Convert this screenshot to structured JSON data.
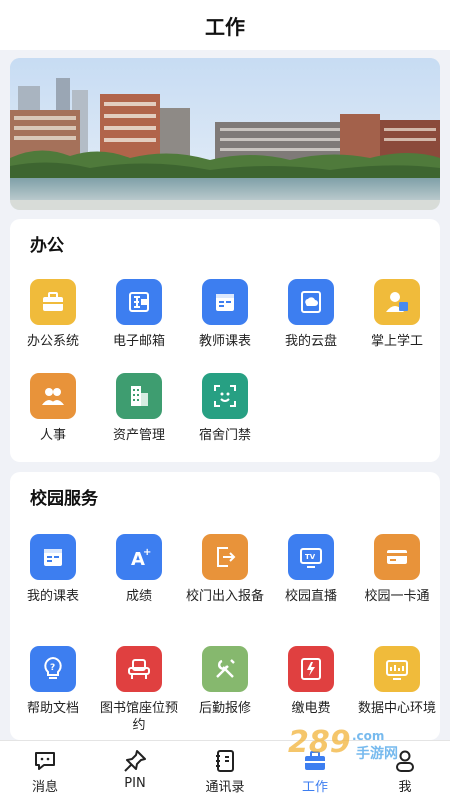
{
  "header": {
    "title": "工作"
  },
  "colors": {
    "accent": "#3d7ef0",
    "yellow": "#f0bb3b",
    "orange": "#e8933a",
    "green": "#3e9d70",
    "red": "#e04040",
    "page_bg": "#f0f2f7"
  },
  "office": {
    "title": "办公",
    "items": [
      {
        "label": "办公系统",
        "icon": "briefcase-icon"
      },
      {
        "label": "电子邮箱",
        "icon": "email-icon"
      },
      {
        "label": "教师课表",
        "icon": "calendar-icon"
      },
      {
        "label": "我的云盘",
        "icon": "cloud-icon"
      },
      {
        "label": "掌上学工",
        "icon": "student-icon"
      },
      {
        "label": "人事",
        "icon": "people-icon"
      },
      {
        "label": "资产管理",
        "icon": "building-icon"
      },
      {
        "label": "宿舍门禁",
        "icon": "face-scan-icon"
      }
    ]
  },
  "campus": {
    "title": "校园服务",
    "items": [
      {
        "label": "我的课表",
        "icon": "calendar-icon"
      },
      {
        "label": "成绩",
        "icon": "grade-icon"
      },
      {
        "label": "校门出入报备",
        "icon": "door-exit-icon"
      },
      {
        "label": "校园直播",
        "icon": "tv-icon"
      },
      {
        "label": "校园一卡通",
        "icon": "card-icon"
      },
      {
        "label": "帮助文档",
        "icon": "help-bulb-icon"
      },
      {
        "label": "图书馆座位预约",
        "icon": "seat-icon"
      },
      {
        "label": "后勤报修",
        "icon": "repair-icon"
      },
      {
        "label": "缴电费",
        "icon": "electric-bill-icon"
      },
      {
        "label": "数据中心环境",
        "icon": "monitor-icon"
      }
    ]
  },
  "tabs": [
    {
      "label": "消息",
      "icon": "message-icon",
      "active": false
    },
    {
      "label": "PIN",
      "icon": "pin-icon",
      "active": false
    },
    {
      "label": "通讯录",
      "icon": "contacts-icon",
      "active": false
    },
    {
      "label": "工作",
      "icon": "work-icon",
      "active": true
    },
    {
      "label": "我",
      "icon": "me-icon",
      "active": false
    }
  ],
  "watermark": {
    "text": "289手游网",
    "sub": "289.com"
  }
}
